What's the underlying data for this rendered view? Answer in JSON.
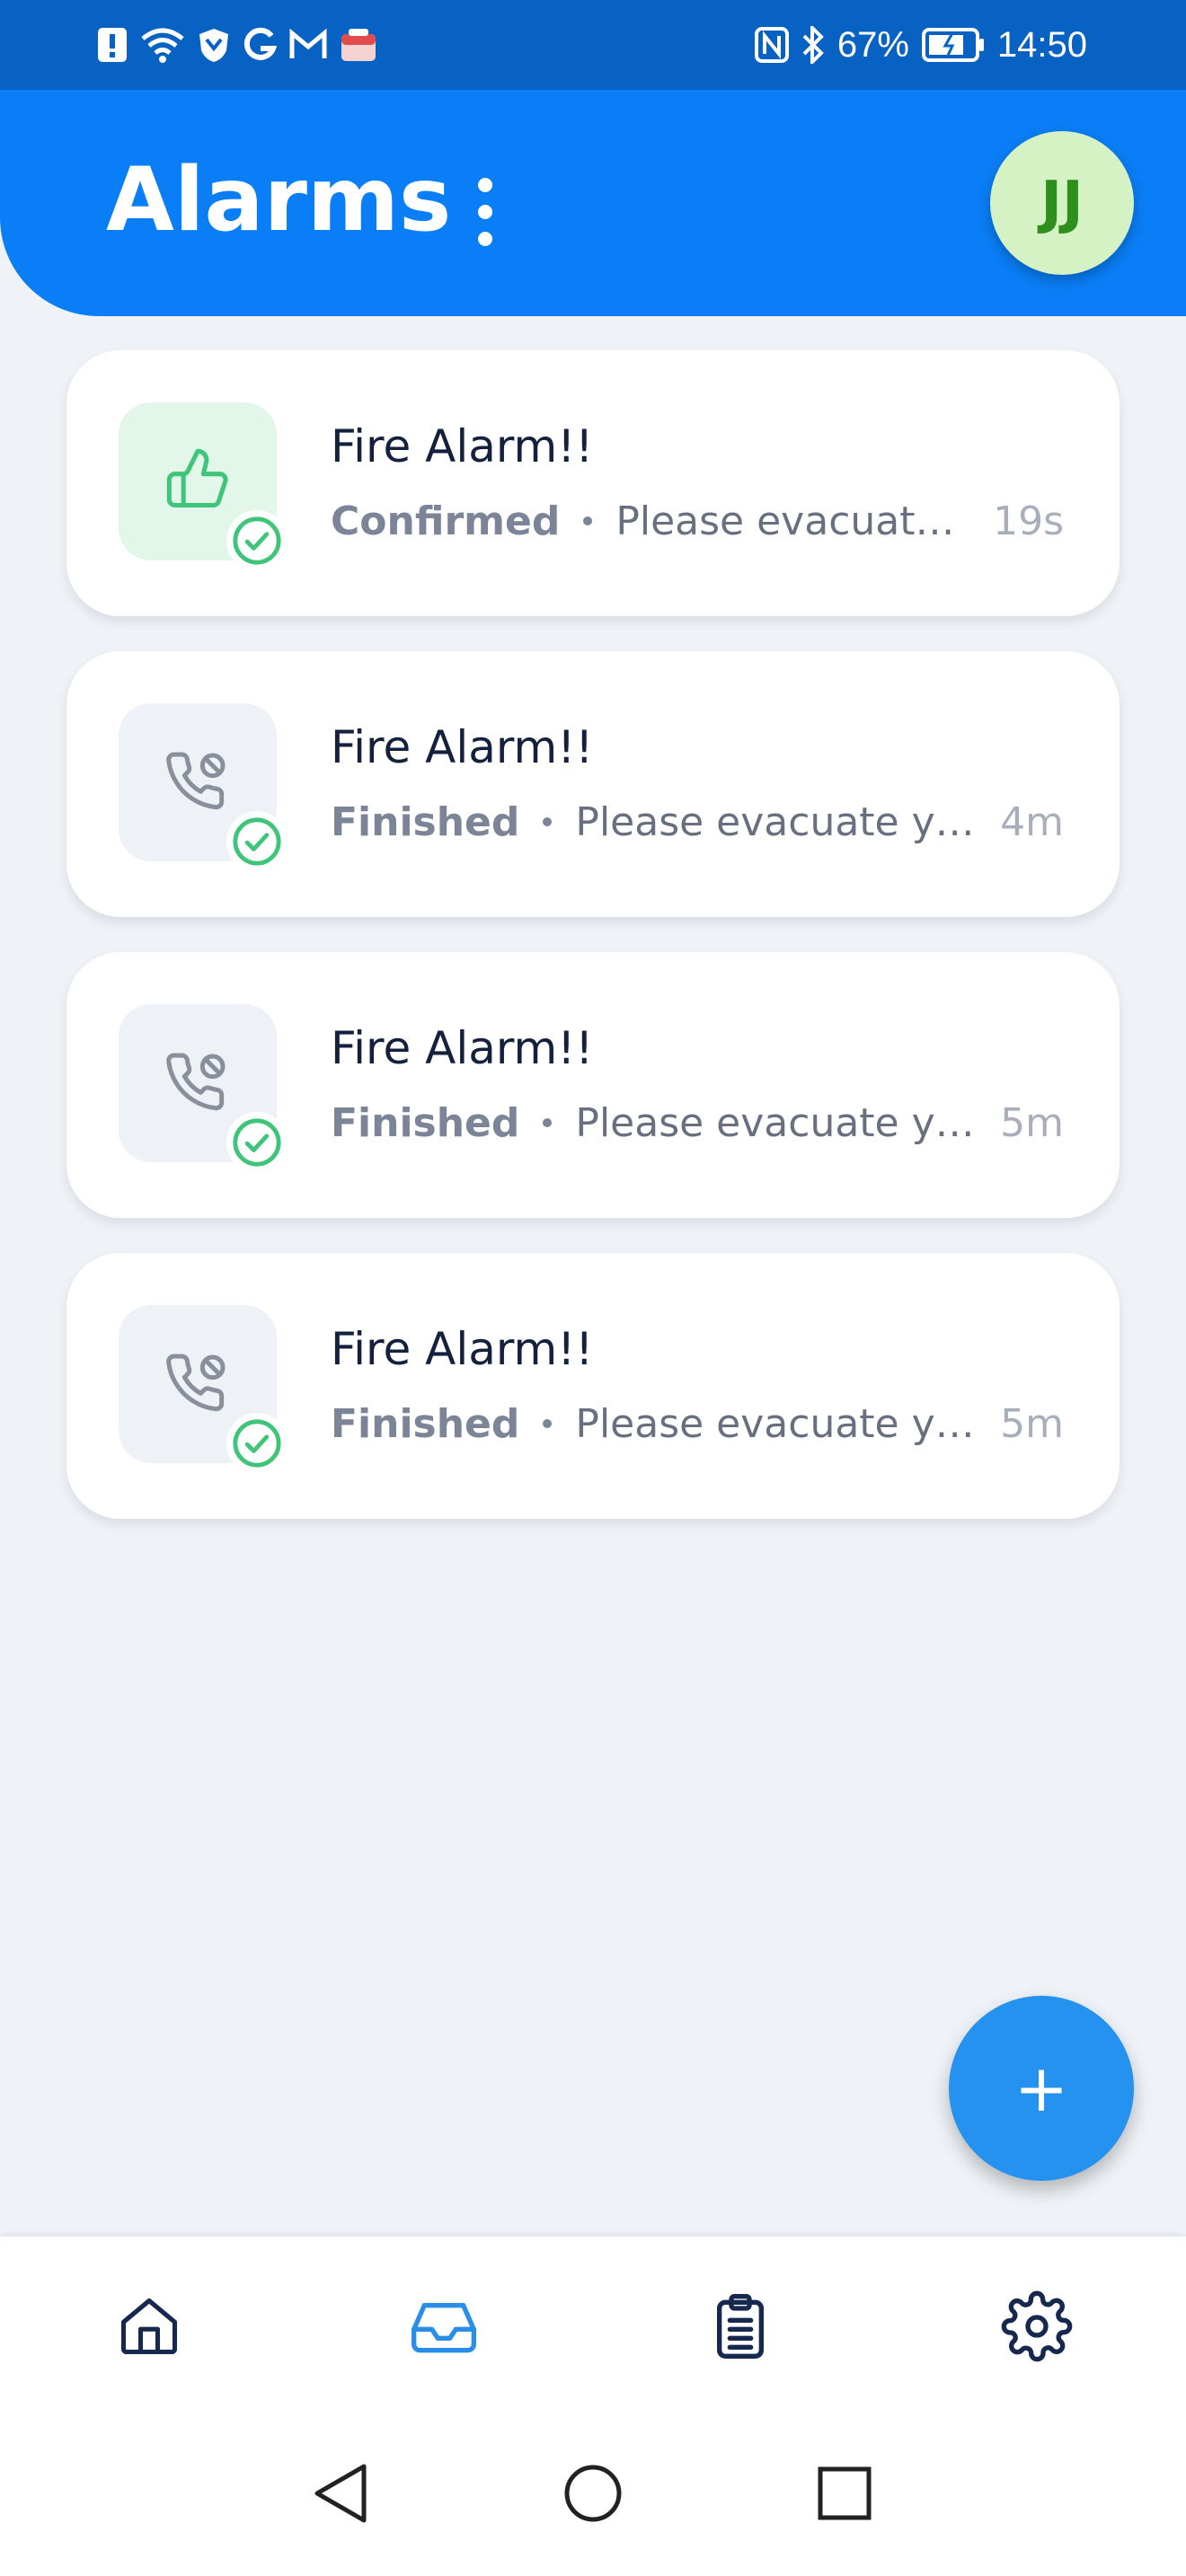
{
  "status_bar": {
    "battery": "67%",
    "time": "14:50",
    "left_icons": [
      "alert-icon",
      "wifi-icon",
      "shield-icon",
      "google-icon",
      "gmail-icon",
      "app-icon"
    ],
    "right_icons": [
      "nfc-icon",
      "bluetooth-icon",
      "battery-icon"
    ]
  },
  "header": {
    "title": "Alarms",
    "avatar_initials": "JJ"
  },
  "alarms": [
    {
      "title": "Fire Alarm!!",
      "status": "Confirmed",
      "message": "Please evacuate you Building",
      "time": "19s",
      "icon": "thumbs-up-icon"
    },
    {
      "title": "Fire Alarm!!",
      "status": "Finished",
      "message": "Please evacuate you Building",
      "time": "4m",
      "icon": "phone-off-icon"
    },
    {
      "title": "Fire Alarm!!",
      "status": "Finished",
      "message": "Please evacuate you Building",
      "time": "5m",
      "icon": "phone-off-icon"
    },
    {
      "title": "Fire Alarm!!",
      "status": "Finished",
      "message": "Please evacuate you Building",
      "time": "5m",
      "icon": "phone-off-icon"
    }
  ],
  "fab": {
    "label": "+"
  },
  "bottom_nav": {
    "items": [
      {
        "icon": "home-icon",
        "active": false
      },
      {
        "icon": "inbox-icon",
        "active": true
      },
      {
        "icon": "clipboard-icon",
        "active": false
      },
      {
        "icon": "settings-icon",
        "active": false
      }
    ]
  },
  "colors": {
    "header": "#0a7ef6",
    "status_bar": "#0762c4",
    "active_nav": "#2a8ee9",
    "check": "#3fc57a",
    "avatar_bg": "#d5f2c4"
  }
}
